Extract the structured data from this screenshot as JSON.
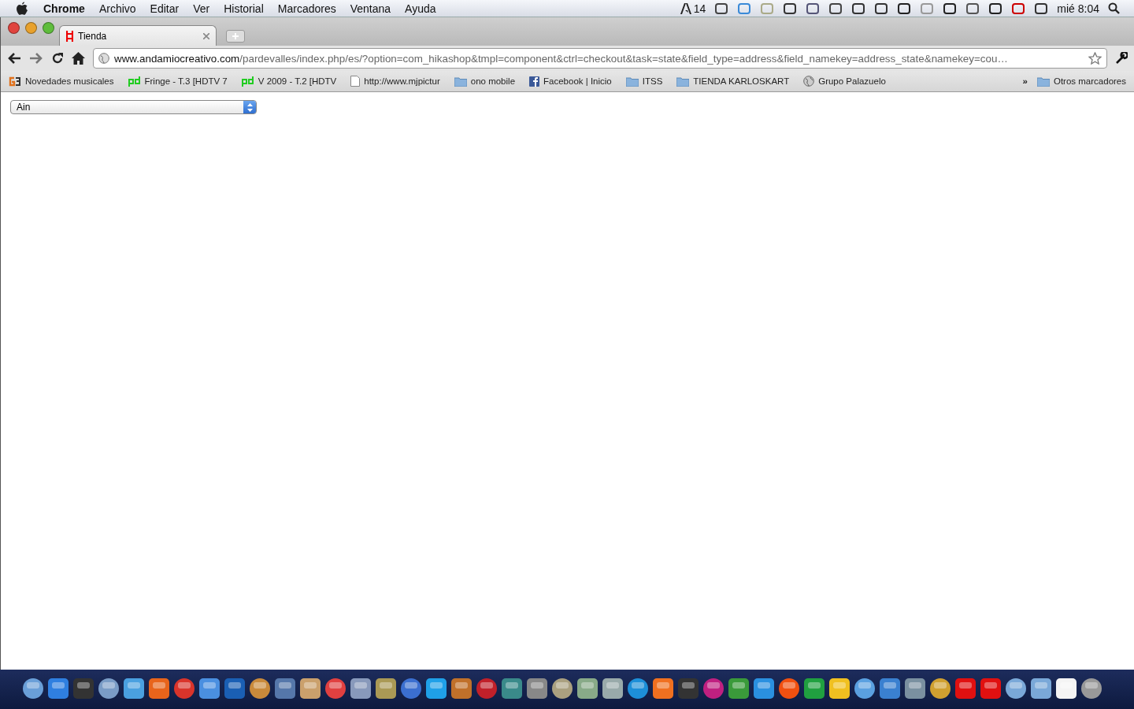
{
  "menu_bar": {
    "app": "Chrome",
    "menus": [
      "Archivo",
      "Editar",
      "Ver",
      "Historial",
      "Marcadores",
      "Ventana",
      "Ayuda"
    ],
    "adobe_count": "14",
    "clock": "mié 8:04"
  },
  "tab": {
    "title": "Tienda",
    "selected": true
  },
  "address_bar": {
    "host": "www.andamiocreativo.com",
    "path": "/pardevalles/index.php/es/?option=com_hikashop&tmpl=component&ctrl=checkout&task=state&field_type=address&field_namekey=address_state&namekey=cou…"
  },
  "bookmarks": [
    {
      "kind": "g3",
      "label": "Novedades musicales"
    },
    {
      "kind": "pd",
      "label": "Fringe - T.3 [HDTV 7"
    },
    {
      "kind": "pd",
      "label": "V 2009 - T.2 [HDTV"
    },
    {
      "kind": "page",
      "label": "http://www.mjpictur"
    },
    {
      "kind": "folder",
      "label": "ono mobile"
    },
    {
      "kind": "facebook",
      "label": "Facebook | Inicio"
    },
    {
      "kind": "folder",
      "label": "ITSS"
    },
    {
      "kind": "folder",
      "label": "TIENDA KARLOSKART"
    },
    {
      "kind": "globe",
      "label": "Grupo Palazuelo"
    }
  ],
  "bookmarks_overflow": "»",
  "other_bookmarks": "Otros marcadores",
  "state_select": {
    "value": "Ain"
  }
}
